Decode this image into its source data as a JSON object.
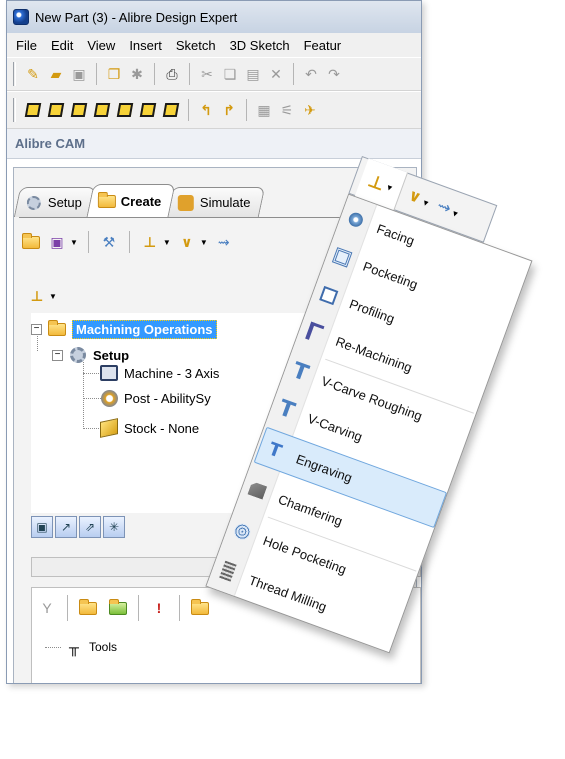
{
  "window": {
    "title": "New Part (3) - Alibre Design Expert"
  },
  "menubar": [
    "File",
    "Edit",
    "View",
    "Insert",
    "Sketch",
    "3D Sketch",
    "Featur"
  ],
  "panel": {
    "title": "Alibre CAM"
  },
  "tabs": [
    {
      "label": "Setup",
      "icon": "setup-gear-icon"
    },
    {
      "label": "Create",
      "icon": "create-folder-icon",
      "active": true
    },
    {
      "label": "Simulate",
      "icon": "simulate-icon"
    }
  ],
  "tree": {
    "root": "Machining Operations",
    "setup": "Setup",
    "children": [
      "Machine - 3 Axis",
      "Post - AbilitySy",
      "Stock - None"
    ]
  },
  "tools_panel": {
    "node": "Tools"
  },
  "dropdown": {
    "items": [
      {
        "label": "Facing",
        "icon": "facing-icon"
      },
      {
        "label": "Pocketing",
        "icon": "pocketing-icon"
      },
      {
        "label": "Profiling",
        "icon": "profiling-icon"
      },
      {
        "label": "Re-Machining",
        "icon": "remachining-icon"
      },
      {
        "label": "V-Carve Roughing",
        "icon": "vcarve-roughing-icon"
      },
      {
        "label": "V-Carving",
        "icon": "vcarving-icon"
      },
      {
        "label": "Engraving",
        "icon": "engraving-icon",
        "highlighted": true
      },
      {
        "label": "Chamfering",
        "icon": "chamfering-icon"
      },
      {
        "label": "Hole Pocketing",
        "icon": "hole-pocketing-icon"
      },
      {
        "label": "Thread Milling",
        "icon": "thread-milling-icon"
      }
    ]
  }
}
